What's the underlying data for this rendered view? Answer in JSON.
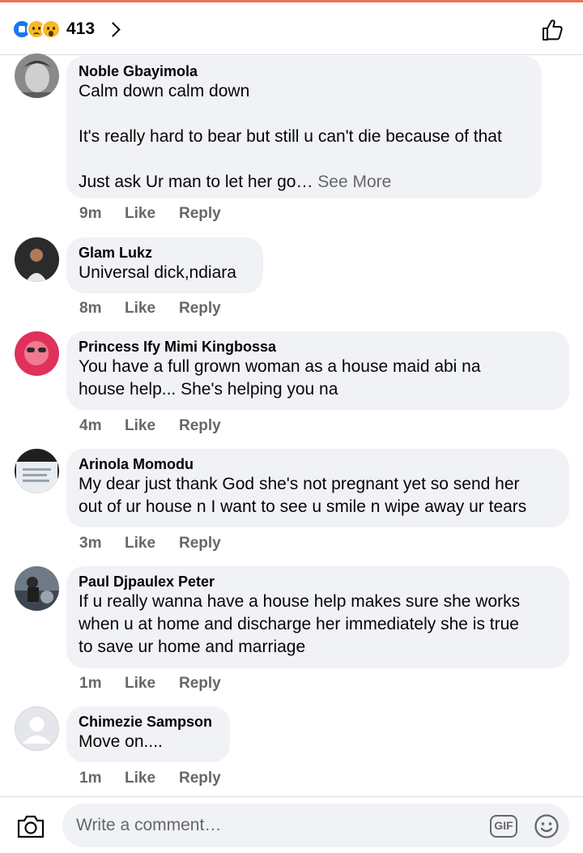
{
  "header": {
    "reactions": [
      "like",
      "sad",
      "wow"
    ],
    "reaction_count": "413",
    "chevron_icon": "chevron-right-icon",
    "like_icon": "thumbs-up-outline-icon"
  },
  "comments": [
    {
      "author": "Noble Gbayimola",
      "text": "Calm down calm down\n\nIt's really hard to bear but still u can't die because of that\n\nJust ask Ur man to let her go…",
      "see_more": " See More",
      "time": "9m",
      "like": "Like",
      "reply": "Reply"
    },
    {
      "author": "Glam Lukz",
      "text": "Universal dick,ndiara",
      "time": "8m",
      "like": "Like",
      "reply": "Reply"
    },
    {
      "author": "Princess Ify Mimi Kingbossa",
      "text": "You have a full grown woman as a house maid abi na\nhouse help... She's helping you na",
      "time": "4m",
      "like": "Like",
      "reply": "Reply"
    },
    {
      "author": "Arinola Momodu",
      "text": "My dear just thank God she's not pregnant yet so send her\nout of ur house n I want to see u smile n wipe away ur tears",
      "time": "3m",
      "like": "Like",
      "reply": "Reply"
    },
    {
      "author": "Paul Djpaulex Peter",
      "text": "If u really wanna have a house help makes sure she works\nwhen u at home and discharge her immediately she is true\nto save ur home and marriage",
      "time": "1m",
      "like": "Like",
      "reply": "Reply"
    },
    {
      "author": "Chimezie Sampson",
      "text": "Move on....",
      "time": "1m",
      "like": "Like",
      "reply": "Reply"
    }
  ],
  "composer": {
    "placeholder": "Write a comment…",
    "gif_label": "GIF",
    "camera_icon": "camera-icon",
    "emoji_icon": "smiley-icon"
  },
  "colors": {
    "accent_top": "#e9744f",
    "bubble_bg": "#f0f2f5",
    "secondary_text": "#65676b",
    "like_blue": "#1877f2"
  }
}
